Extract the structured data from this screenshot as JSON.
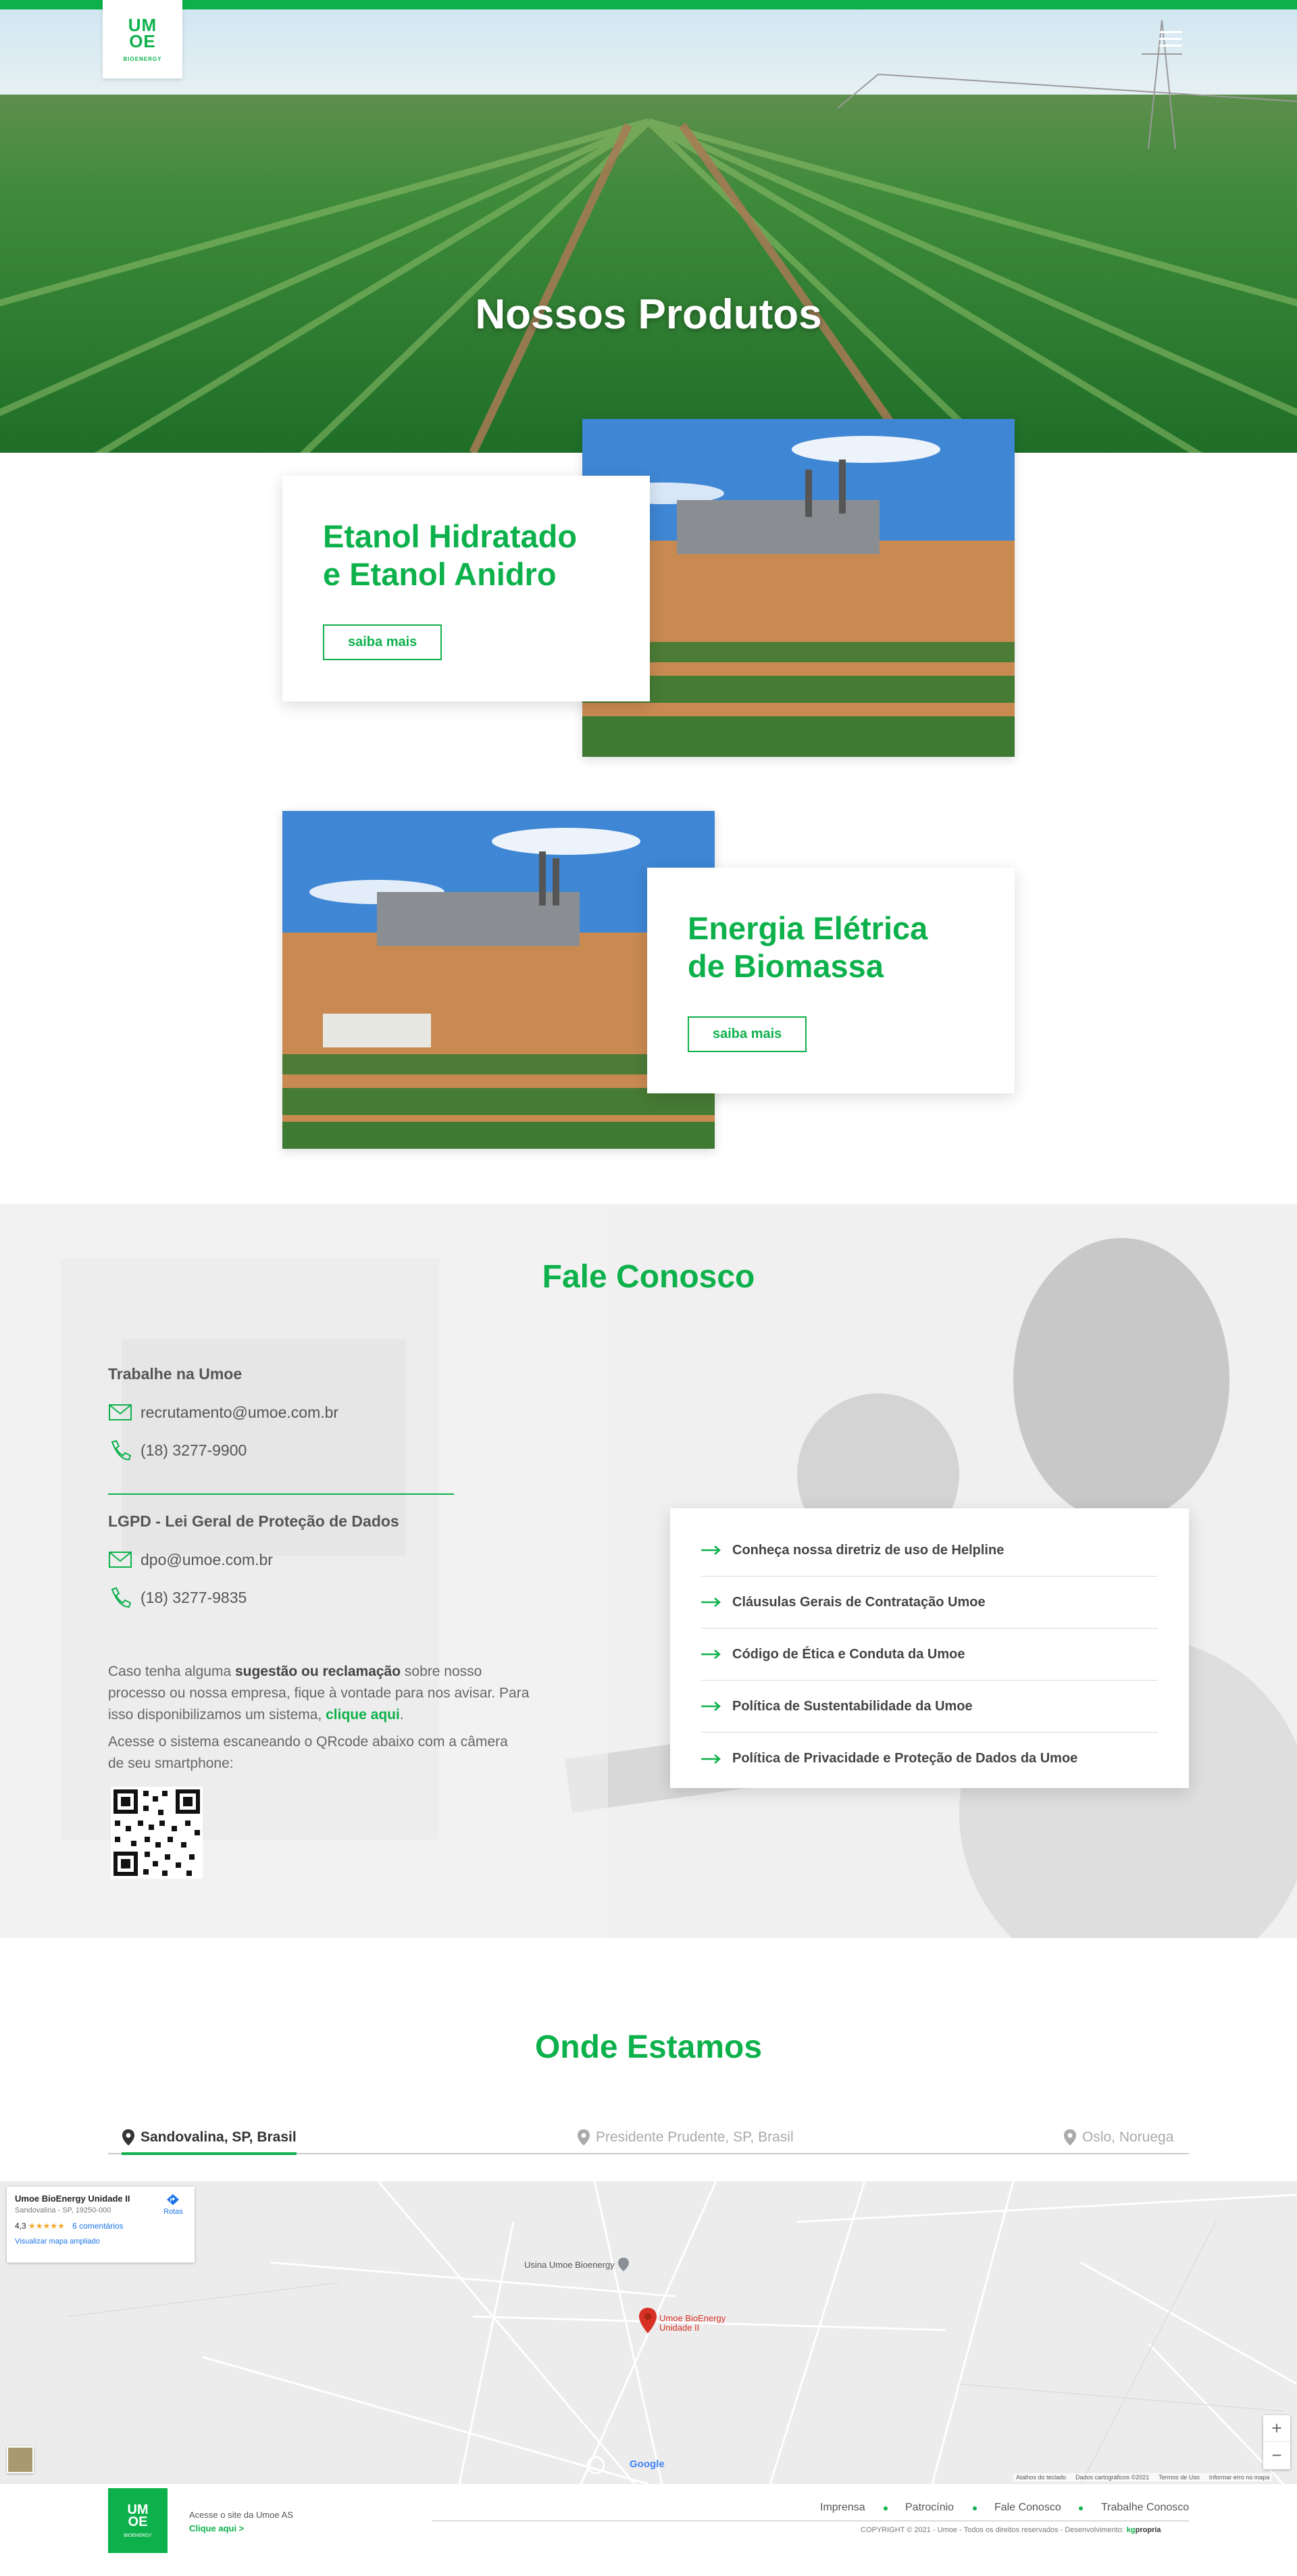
{
  "header": {
    "logo_text_line1": "UM",
    "logo_text_line2": "OE",
    "logo_sub": "BIOENERGY",
    "menu_icon": "hamburger-icon",
    "hero_title": "Nossos Produtos"
  },
  "products": [
    {
      "title_line1": "Etanol Hidratado",
      "title_line2": "e Etanol Anidro",
      "button": "saiba mais"
    },
    {
      "title_line1": "Energia Elétrica",
      "title_line2": "de Biomassa",
      "button": "saiba mais"
    }
  ],
  "contact": {
    "title": "Fale Conosco",
    "work_heading": "Trabalhe na Umoe",
    "work_email": "recrutamento@umoe.com.br",
    "work_phone": "(18) 3277-9900",
    "lgpd_heading": "LGPD - Lei Geral de Proteção de Dados",
    "lgpd_email": "dpo@umoe.com.br",
    "lgpd_phone": "(18) 3277-9835",
    "para1_a": "Caso tenha alguma ",
    "para1_b": "sugestão ou reclamação",
    "para1_c": " sobre nosso processo ou nossa empresa, fique à vontade para nos avisar. Para isso disponibilizamos um sistema, ",
    "para1_link": "clique aqui",
    "para1_end": ".",
    "para2": "Acesse o sistema escaneando o QRcode abaixo com a câmera de seu smartphone:",
    "links": [
      "Conheça nossa diretriz de uso de Helpline",
      "Cláusulas Gerais de Contratação Umoe",
      "Código de Ética e Conduta da Umoe",
      "Política de Sustentabilidade da Umoe",
      "Política de Privacidade e Proteção de Dados da Umoe"
    ],
    "accent": "#0db14b"
  },
  "locations": {
    "title": "Onde Estamos",
    "tabs": [
      "Sandovalina, SP, Brasil",
      "Presidente Prudente, SP, Brasil",
      "Oslo, Noruega"
    ]
  },
  "map": {
    "place_name": "Umoe BioEnergy Unidade II",
    "place_address": "Sandovalina - SP, 19250-000",
    "rating": "4,3",
    "stars": "★★★★★",
    "reviews": "6 comentários",
    "enlarge": "Visualizar mapa ampliado",
    "directions": "Rotas",
    "poi_label": "Usina Umoe Bioenergy",
    "pin_label_line1": "Umoe BioEnergy",
    "pin_label_line2": "Unidade II",
    "google": "Google",
    "shortcuts": "Atalhos do teclado",
    "map_data": "Dados cartográficos ©2021",
    "terms": "Termos de Uso",
    "report": "Informar erro no mapa",
    "zoom_in": "+",
    "zoom_out": "−"
  },
  "footer": {
    "logo_line1": "UM",
    "logo_line2": "OE",
    "logo_sub": "BIOENERGY",
    "access_text": "Acesse o site da Umoe AS",
    "access_link": "Clique aqui >",
    "nav": [
      "Imprensa",
      "Patrocínio",
      "Fale Conosco",
      "Trabalhe Conosco"
    ],
    "copyright": "COPYRIGHT © 2021 - Umoe - Todos os direitos reservados - Desenvolvimento:",
    "dev_brand": "propria",
    "dev_prefix": "kg"
  }
}
